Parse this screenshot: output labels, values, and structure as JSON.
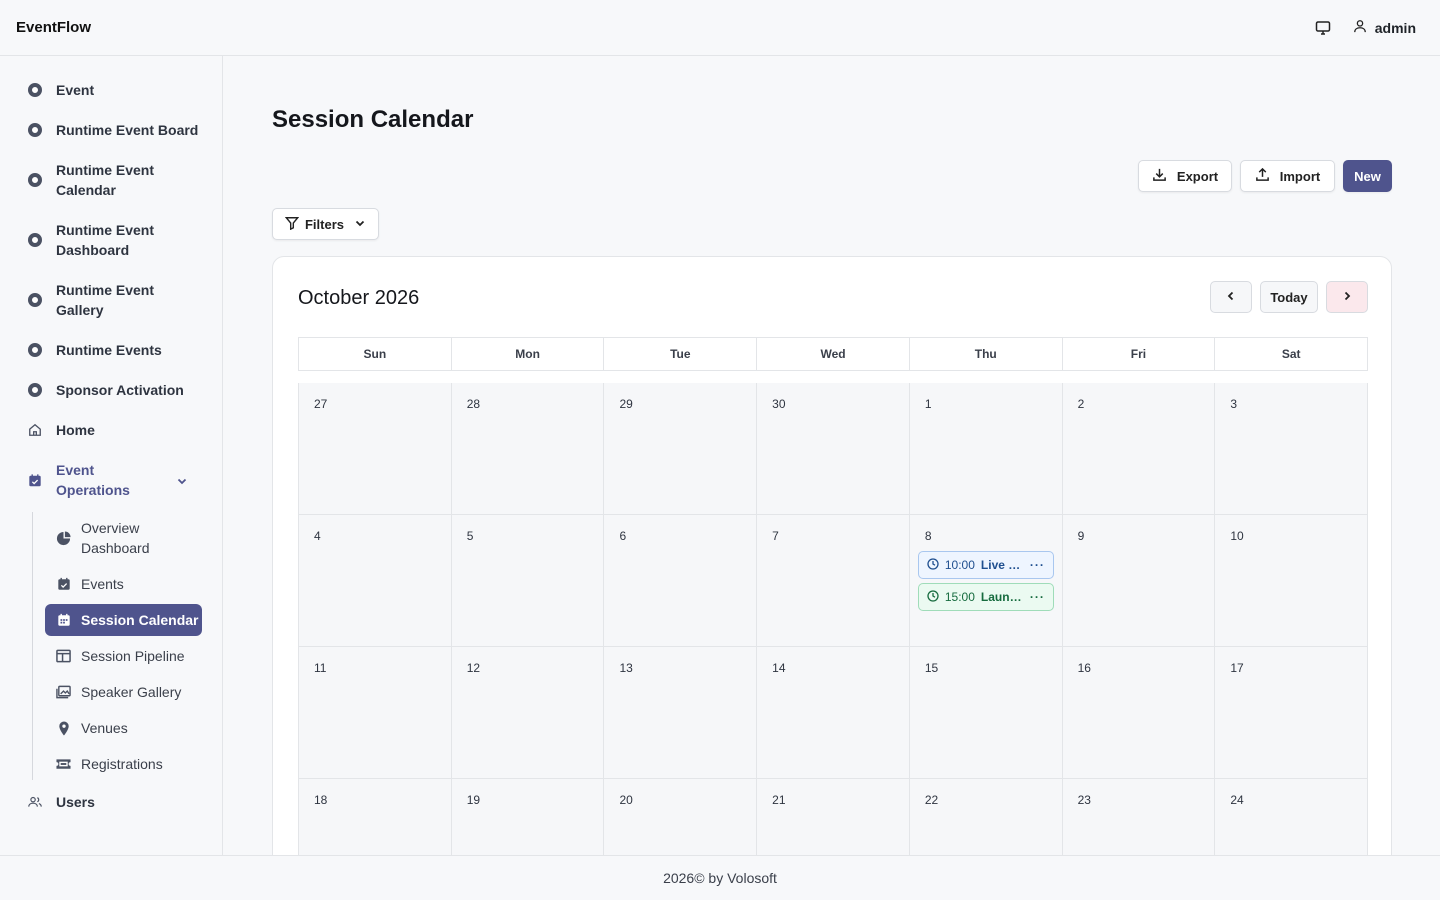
{
  "app": {
    "brand": "EventFlow",
    "user": "admin"
  },
  "sidebar": {
    "items": [
      {
        "label": "Event",
        "icon": "circle-dot-icon"
      },
      {
        "label": "Runtime Event Board",
        "icon": "circle-dot-icon"
      },
      {
        "label": "Runtime Event Calendar",
        "icon": "circle-dot-icon"
      },
      {
        "label": "Runtime Event Dashboard",
        "icon": "circle-dot-icon"
      },
      {
        "label": "Runtime Event Gallery",
        "icon": "circle-dot-icon"
      },
      {
        "label": "Runtime Events",
        "icon": "circle-dot-icon"
      },
      {
        "label": "Sponsor Activation",
        "icon": "circle-dot-icon"
      },
      {
        "label": "Home",
        "icon": "home-icon"
      },
      {
        "label": "Event Operations",
        "icon": "calendar-check-icon"
      }
    ],
    "sub_items": [
      {
        "label": "Overview Dashboard",
        "icon": "pie-chart-icon"
      },
      {
        "label": "Events",
        "icon": "calendar-check-icon"
      },
      {
        "label": "Session Calendar",
        "icon": "calendar-grid-icon",
        "active": true
      },
      {
        "label": "Session Pipeline",
        "icon": "columns-icon"
      },
      {
        "label": "Speaker Gallery",
        "icon": "images-icon"
      },
      {
        "label": "Venues",
        "icon": "map-pin-icon"
      },
      {
        "label": "Registrations",
        "icon": "ticket-icon"
      }
    ],
    "bottom_items": [
      {
        "label": "Users",
        "icon": "users-icon"
      }
    ]
  },
  "page": {
    "title": "Session Calendar",
    "export_label": "Export",
    "import_label": "Import",
    "new_label": "New",
    "filters_label": "Filters"
  },
  "calendar": {
    "month_title": "October 2026",
    "today_label": "Today",
    "days_of_week": [
      "Sun",
      "Mon",
      "Tue",
      "Wed",
      "Thu",
      "Fri",
      "Sat"
    ],
    "weeks": [
      [
        "27",
        "28",
        "29",
        "30",
        "1",
        "2",
        "3"
      ],
      [
        "4",
        "5",
        "6",
        "7",
        "8",
        "9",
        "10"
      ],
      [
        "11",
        "12",
        "13",
        "14",
        "15",
        "16",
        "17"
      ],
      [
        "18",
        "19",
        "20",
        "21",
        "22",
        "23",
        "24"
      ]
    ],
    "events": [
      {
        "day": "8",
        "time": "10:00",
        "name": "Live O...",
        "color": "#eef5ff"
      },
      {
        "day": "8",
        "time": "15:00",
        "name": "Launch...",
        "color": "#ebfaf1"
      }
    ]
  },
  "footer": {
    "text": "2026© by Volosoft"
  },
  "colors": {
    "accent": "#4f548d",
    "today_next": "#fbe8ec"
  }
}
